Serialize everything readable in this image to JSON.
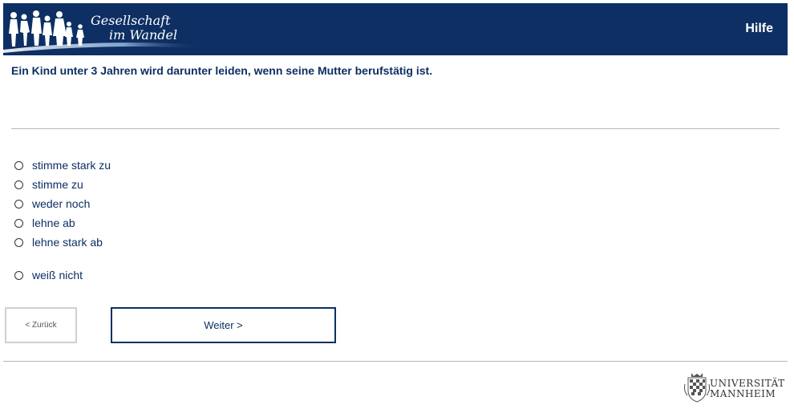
{
  "header": {
    "logo_line1": "Gesellschaft",
    "logo_line2": "im Wandel",
    "help_label": "Hilfe",
    "bg_color": "#0d2f63",
    "icons": [
      "people-silhouettes-icon"
    ]
  },
  "question": {
    "text": "Ein Kind unter 3 Jahren wird darunter leiden, wenn seine Mutter berufstätig ist."
  },
  "options": [
    {
      "label": "stimme stark zu",
      "selected": false
    },
    {
      "label": "stimme zu",
      "selected": false
    },
    {
      "label": "weder noch",
      "selected": false
    },
    {
      "label": "lehne ab",
      "selected": false
    },
    {
      "label": "lehne stark ab",
      "selected": false
    },
    {
      "label": "weiß nicht",
      "selected": false
    }
  ],
  "navigation": {
    "back_label": "< Zurück",
    "next_label": "Weiter >"
  },
  "footer": {
    "university_line1": "UNIVERSITÄT",
    "university_line2": "MANNHEIM",
    "icons": [
      "university-seal-icon"
    ]
  }
}
